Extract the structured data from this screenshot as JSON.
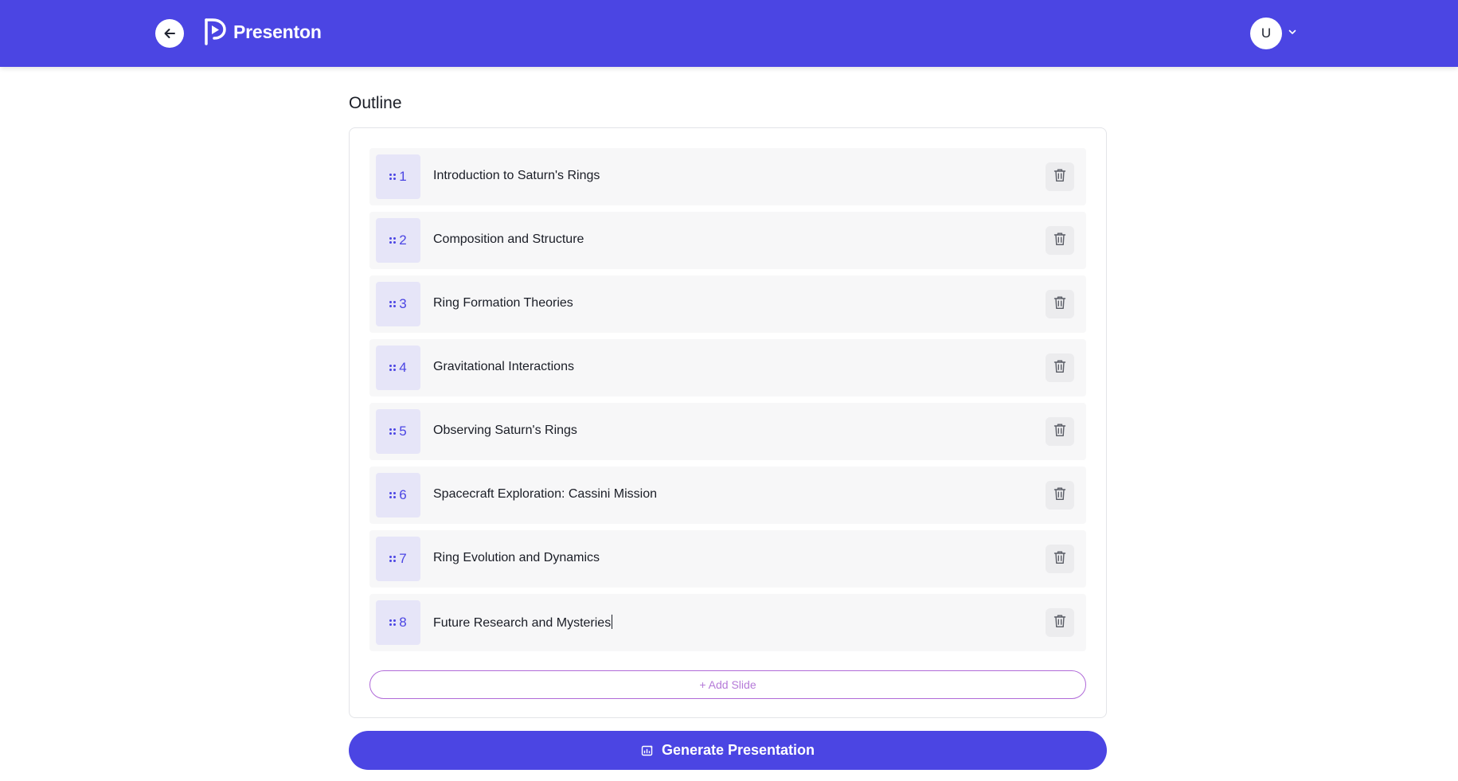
{
  "header": {
    "brand_name": "Presenton",
    "user_initial": "U",
    "accent_color": "#4b45e3"
  },
  "outline": {
    "title": "Outline",
    "slides": [
      {
        "number": "1",
        "title": "Introduction to Saturn's Rings"
      },
      {
        "number": "2",
        "title": "Composition and Structure"
      },
      {
        "number": "3",
        "title": "Ring Formation Theories"
      },
      {
        "number": "4",
        "title": "Gravitational Interactions"
      },
      {
        "number": "5",
        "title": "Observing Saturn's Rings"
      },
      {
        "number": "6",
        "title": "Spacecraft Exploration: Cassini Mission"
      },
      {
        "number": "7",
        "title": "Ring Evolution and Dynamics"
      },
      {
        "number": "8",
        "title": "Future Research and Mysteries"
      }
    ],
    "add_slide_label": "+ Add Slide"
  },
  "actions": {
    "generate_label": "Generate Presentation"
  },
  "icons": {
    "back": "arrow-left-icon",
    "logo": "presenton-logo-icon",
    "dropdown": "chevron-down-icon",
    "drag": "drag-handle-icon",
    "delete": "trash-icon",
    "generate": "chart-sparkle-icon"
  }
}
